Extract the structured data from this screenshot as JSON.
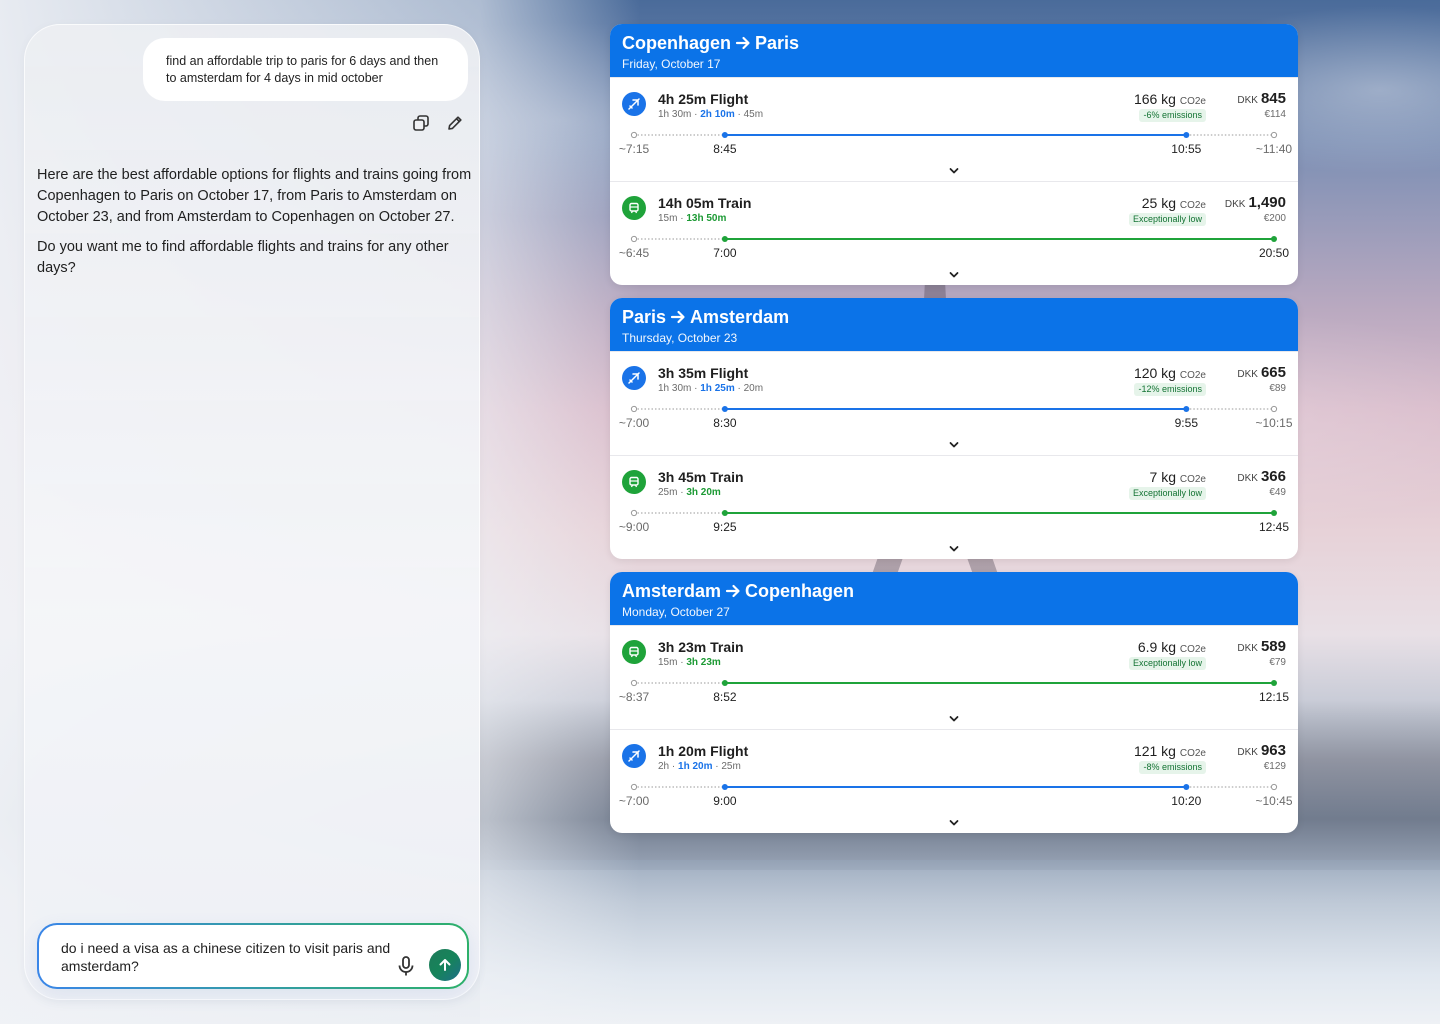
{
  "chat": {
    "user_message": "find an affordable trip to paris for 6 days and then to amsterdam for 4 days in mid october",
    "assistant_paragraphs": [
      "Here are the best affordable options for flights and trains going from Copenhagen to Paris on October 17, from Paris to Amsterdam on October 23, and from Amsterdam to Copenhagen on October 27.",
      "Do you want me to find affordable flights and trains for any other days?"
    ],
    "input_value": "do i need a visa as a chinese citizen to visit paris and amsterdam?",
    "icons": {
      "copy": "copy-icon",
      "edit": "pencil-icon",
      "mic": "microphone-icon",
      "send": "arrow-up-icon"
    }
  },
  "colors": {
    "header_blue": "#0b73e8",
    "flight_blue": "#1a73e8",
    "train_green": "#1fa33a"
  },
  "trips": [
    {
      "from": "Copenhagen",
      "to": "Paris",
      "date": "Friday, October 17",
      "options": [
        {
          "mode": "flight",
          "title": "4h 25m Flight",
          "sub_a": "1h 30m · ",
          "sub_hl": "2h 10m",
          "sub_b": " · 45m",
          "co2_value": "166 kg",
          "co2_unit": "CO2e",
          "badge": "-6% emissions",
          "currency": "DKK",
          "price": "845",
          "price_eur": "€114",
          "times": {
            "depart_home": "~7:15",
            "depart": "8:45",
            "arrive": "10:55",
            "arrive_dest": "~11:40"
          },
          "progress": {
            "depart": 0.142,
            "arrive": 0.863
          }
        },
        {
          "mode": "train",
          "title": "14h 05m Train",
          "sub_a": "15m · ",
          "sub_hl": "13h 50m",
          "sub_b": "",
          "co2_value": "25 kg",
          "co2_unit": "CO2e",
          "badge": "Exceptionally low",
          "currency": "DKK",
          "price": "1,490",
          "price_eur": "€200",
          "times": {
            "depart_home": "~6:45",
            "depart": "7:00",
            "arrive": "20:50",
            "arrive_dest": ""
          },
          "progress": {
            "depart": 0.142,
            "arrive": 1.0
          }
        }
      ]
    },
    {
      "from": "Paris",
      "to": "Amsterdam",
      "date": "Thursday, October 23",
      "options": [
        {
          "mode": "flight",
          "title": "3h 35m Flight",
          "sub_a": "1h 30m · ",
          "sub_hl": "1h 25m",
          "sub_b": " · 20m",
          "co2_value": "120 kg",
          "co2_unit": "CO2e",
          "badge": "-12% emissions",
          "currency": "DKK",
          "price": "665",
          "price_eur": "€89",
          "times": {
            "depart_home": "~7:00",
            "depart": "8:30",
            "arrive": "9:55",
            "arrive_dest": "~10:15"
          },
          "progress": {
            "depart": 0.142,
            "arrive": 0.863
          }
        },
        {
          "mode": "train",
          "title": "3h 45m Train",
          "sub_a": "25m · ",
          "sub_hl": "3h 20m",
          "sub_b": "",
          "co2_value": "7 kg",
          "co2_unit": "CO2e",
          "badge": "Exceptionally low",
          "currency": "DKK",
          "price": "366",
          "price_eur": "€49",
          "times": {
            "depart_home": "~9:00",
            "depart": "9:25",
            "arrive": "12:45",
            "arrive_dest": ""
          },
          "progress": {
            "depart": 0.142,
            "arrive": 1.0
          }
        }
      ]
    },
    {
      "from": "Amsterdam",
      "to": "Copenhagen",
      "date": "Monday, October 27",
      "options": [
        {
          "mode": "train",
          "title": "3h 23m Train",
          "sub_a": "15m · ",
          "sub_hl": "3h 23m",
          "sub_b": "",
          "co2_value": "6.9 kg",
          "co2_unit": "CO2e",
          "badge": "Exceptionally low",
          "currency": "DKK",
          "price": "589",
          "price_eur": "€79",
          "times": {
            "depart_home": "~8:37",
            "depart": "8:52",
            "arrive": "12:15",
            "arrive_dest": ""
          },
          "progress": {
            "depart": 0.142,
            "arrive": 1.0
          }
        },
        {
          "mode": "flight",
          "title": "1h 20m Flight",
          "sub_a": "2h · ",
          "sub_hl": "1h 20m",
          "sub_b": " · 25m",
          "co2_value": "121 kg",
          "co2_unit": "CO2e",
          "badge": "-8% emissions",
          "currency": "DKK",
          "price": "963",
          "price_eur": "€129",
          "times": {
            "depart_home": "~7:00",
            "depart": "9:00",
            "arrive": "10:20",
            "arrive_dest": "~10:45"
          },
          "progress": {
            "depart": 0.142,
            "arrive": 0.863
          }
        }
      ]
    }
  ]
}
